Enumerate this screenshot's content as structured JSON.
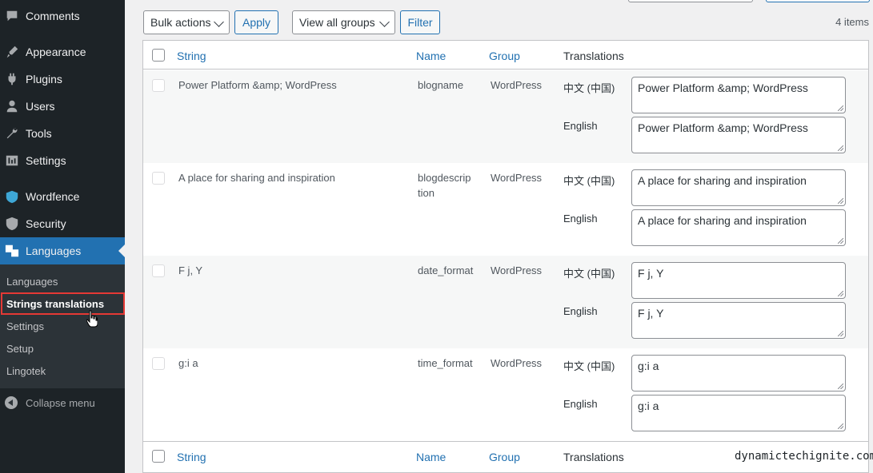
{
  "sidebar": {
    "items": [
      {
        "label": "Comments",
        "icon": "comments-icon"
      },
      {
        "label": "Appearance",
        "icon": "appearance-icon"
      },
      {
        "label": "Plugins",
        "icon": "plugins-icon"
      },
      {
        "label": "Users",
        "icon": "users-icon"
      },
      {
        "label": "Tools",
        "icon": "tools-icon"
      },
      {
        "label": "Settings",
        "icon": "settings-icon"
      },
      {
        "label": "Wordfence",
        "icon": "wordfence-icon"
      },
      {
        "label": "Security",
        "icon": "security-icon"
      },
      {
        "label": "Languages",
        "icon": "languages-icon",
        "active": true
      }
    ],
    "submenu": [
      {
        "label": "Languages"
      },
      {
        "label": "Strings translations",
        "current": true
      },
      {
        "label": "Settings"
      },
      {
        "label": "Setup"
      },
      {
        "label": "Lingotek"
      }
    ],
    "collapse_label": "Collapse menu"
  },
  "toolbar": {
    "bulk_actions": "Bulk actions",
    "apply": "Apply",
    "group_filter": "View all groups",
    "filter": "Filter",
    "items_count": "4 items"
  },
  "table": {
    "columns": {
      "string": "String",
      "name": "Name",
      "group": "Group",
      "translations": "Translations"
    },
    "rows": [
      {
        "string": "Power Platform &amp; WordPress",
        "name": "blogname",
        "group": "WordPress",
        "translations": [
          {
            "lang": "中文 (中国)",
            "value": "Power Platform &amp; WordPress"
          },
          {
            "lang": "English",
            "value": "Power Platform &amp; WordPress"
          }
        ]
      },
      {
        "string": "A place for sharing and inspiration",
        "name_line1": "blogdescrip",
        "name_line2": "tion",
        "group": "WordPress",
        "translations": [
          {
            "lang": "中文 (中国)",
            "value": "A place for sharing and inspiration"
          },
          {
            "lang": "English",
            "value": "A place for sharing and inspiration"
          }
        ]
      },
      {
        "string": "F j, Y",
        "name": "date_format",
        "group": "WordPress",
        "translations": [
          {
            "lang": "中文 (中国)",
            "value": "F j, Y"
          },
          {
            "lang": "English",
            "value": "F j, Y"
          }
        ]
      },
      {
        "string": "g:i a",
        "name": "time_format",
        "group": "WordPress",
        "translations": [
          {
            "lang": "中文 (中国)",
            "value": "g:i a"
          },
          {
            "lang": "English",
            "value": "g:i a"
          }
        ]
      }
    ]
  },
  "watermark": "dynamictechignite.com",
  "colors": {
    "sidebar_bg": "#1d2327",
    "active": "#2271b1",
    "highlight": "#e53935"
  }
}
